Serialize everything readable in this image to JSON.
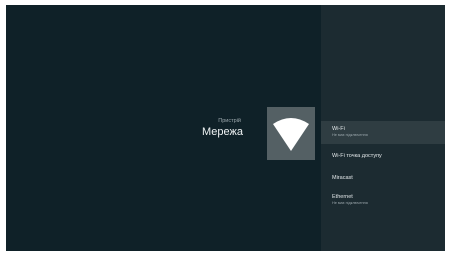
{
  "header": {
    "breadcrumb": "Пристрій",
    "title": "Мережа"
  },
  "tile": {
    "icon": "wifi-icon"
  },
  "menu": {
    "items": [
      {
        "label": "Wi-Fi",
        "subtitle": "Не має підключення"
      },
      {
        "label": "Wi-Fi точка доступу"
      },
      {
        "label": "Miracast"
      },
      {
        "label": "Ethernet",
        "subtitle": "Не має підключення"
      }
    ]
  },
  "colors": {
    "background": "#0f2128",
    "panel": "#1c2b31",
    "selected": "#2f3d42",
    "tile": "#546064",
    "icon": "#ffffff"
  }
}
